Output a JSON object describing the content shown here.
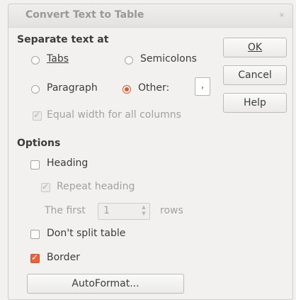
{
  "dialog": {
    "title": "Convert Text to Table",
    "close_glyph": "×"
  },
  "separate": {
    "heading": "Separate text at",
    "tabs_label": "Tabs",
    "semicolons_label": "Semicolons",
    "paragraph_label": "Paragraph",
    "other_label": "Other:",
    "other_value": ",",
    "equal_width_label": "Equal width for all columns",
    "selected": "Other"
  },
  "buttons": {
    "ok": "OK",
    "cancel": "Cancel",
    "help": "Help",
    "autoformat": "AutoFormat..."
  },
  "options": {
    "heading": "Options",
    "heading_label": "Heading",
    "repeat_heading_label": "Repeat heading",
    "the_first_label": "The first",
    "rows_value": "1",
    "rows_label": "rows",
    "dont_split_label": "Don't split table",
    "border_label": "Border",
    "border_checked": true
  },
  "colors": {
    "accent": "#e8643b",
    "background": "#f2f1f0"
  }
}
